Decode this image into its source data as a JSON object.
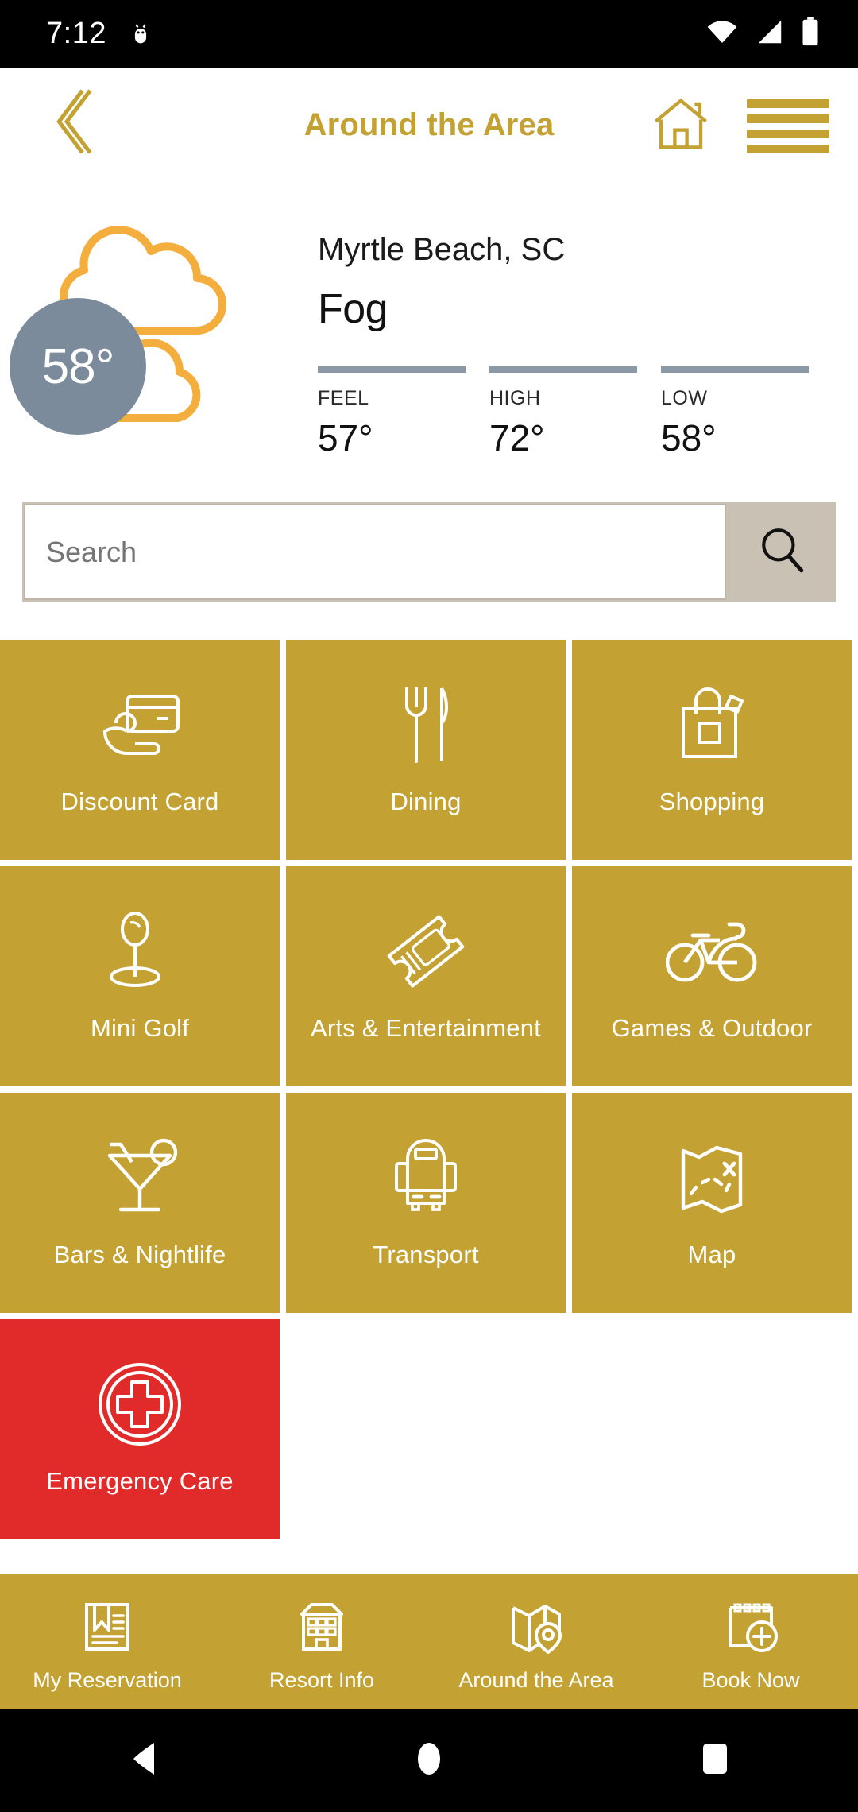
{
  "statusbar": {
    "time": "7:12",
    "icons": [
      "android-bug-icon",
      "wifi-icon",
      "cellular-signal-icon",
      "battery-icon"
    ]
  },
  "header": {
    "title": "Around the Area",
    "back_icon": "chevron-left-icon",
    "home_icon": "home-icon",
    "menu_icon": "hamburger-menu-icon",
    "accent_color": "#C3A233"
  },
  "weather": {
    "temperature": "58°",
    "city": "Myrtle Beach, SC",
    "condition": "Fog",
    "condition_icon": "cloud-icon",
    "badge_color": "#7C8B9B",
    "cloud_color": "#F4AE3D",
    "stats": [
      {
        "label": "FEEL",
        "value": "57°"
      },
      {
        "label": "HIGH",
        "value": "72°"
      },
      {
        "label": "LOW",
        "value": "58°"
      }
    ]
  },
  "search": {
    "value": "",
    "placeholder": "Search",
    "button_icon": "search-icon",
    "button_color": "#C9C2B4"
  },
  "grid": {
    "tile_color": "#C3A233",
    "emergency_color": "#E12B2B",
    "rows": [
      [
        {
          "label": "Discount Card",
          "icon": "credit-card-hand-icon",
          "color": "#C3A233"
        },
        {
          "label": "Dining",
          "icon": "fork-knife-icon",
          "color": "#C3A233"
        },
        {
          "label": "Shopping",
          "icon": "shopping-bag-icon",
          "color": "#C3A233"
        }
      ],
      [
        {
          "label": "Mini Golf",
          "icon": "golf-hole-icon",
          "color": "#C3A233"
        },
        {
          "label": "Arts & Entertainment",
          "icon": "ticket-icon",
          "color": "#C3A233"
        },
        {
          "label": "Games & Outdoor",
          "icon": "bicycle-icon",
          "color": "#C3A233"
        }
      ],
      [
        {
          "label": "Bars & Nightlife",
          "icon": "cocktail-glass-icon",
          "color": "#C3A233"
        },
        {
          "label": "Transport",
          "icon": "bus-icon",
          "color": "#C3A233"
        },
        {
          "label": "Map",
          "icon": "treasure-map-icon",
          "color": "#C3A233"
        }
      ],
      [
        {
          "label": "Emergency Care",
          "icon": "medical-cross-circle-icon",
          "color": "#E12B2B"
        }
      ]
    ]
  },
  "bottomnav": {
    "background": "#C3A233",
    "items": [
      {
        "label": "My Reservation",
        "icon": "bookmarked-document-icon"
      },
      {
        "label": "Resort Info",
        "icon": "building-icon"
      },
      {
        "label": "Around the Area",
        "icon": "map-pin-icon"
      },
      {
        "label": "Book Now",
        "icon": "calendar-plus-icon"
      }
    ]
  },
  "androidnav": {
    "back_icon": "triangle-back-icon",
    "home_icon": "circle-home-icon",
    "recents_icon": "square-recents-icon"
  }
}
